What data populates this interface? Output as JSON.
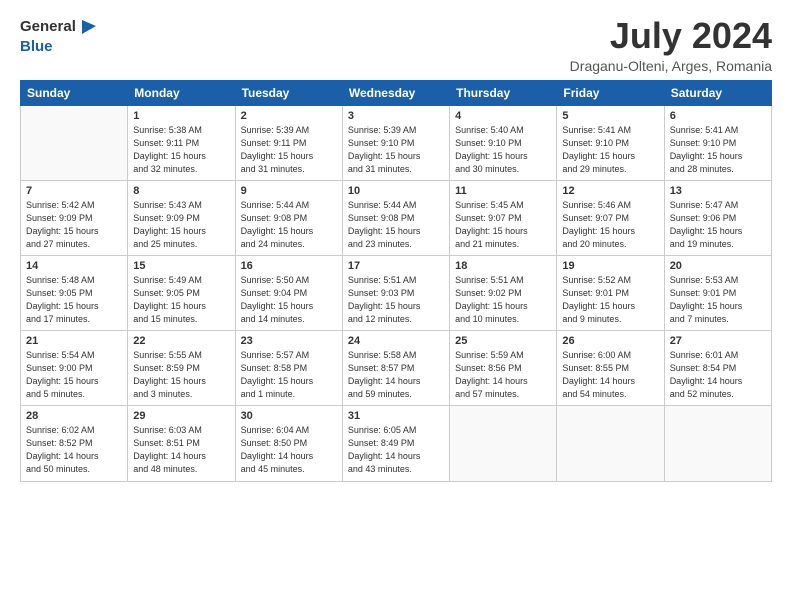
{
  "logo": {
    "line1": "General",
    "line2": "Blue"
  },
  "title": "July 2024",
  "subtitle": "Draganu-Olteni, Arges, Romania",
  "days_of_week": [
    "Sunday",
    "Monday",
    "Tuesday",
    "Wednesday",
    "Thursday",
    "Friday",
    "Saturday"
  ],
  "weeks": [
    [
      {
        "day": "",
        "info": ""
      },
      {
        "day": "1",
        "info": "Sunrise: 5:38 AM\nSunset: 9:11 PM\nDaylight: 15 hours\nand 32 minutes."
      },
      {
        "day": "2",
        "info": "Sunrise: 5:39 AM\nSunset: 9:11 PM\nDaylight: 15 hours\nand 31 minutes."
      },
      {
        "day": "3",
        "info": "Sunrise: 5:39 AM\nSunset: 9:10 PM\nDaylight: 15 hours\nand 31 minutes."
      },
      {
        "day": "4",
        "info": "Sunrise: 5:40 AM\nSunset: 9:10 PM\nDaylight: 15 hours\nand 30 minutes."
      },
      {
        "day": "5",
        "info": "Sunrise: 5:41 AM\nSunset: 9:10 PM\nDaylight: 15 hours\nand 29 minutes."
      },
      {
        "day": "6",
        "info": "Sunrise: 5:41 AM\nSunset: 9:10 PM\nDaylight: 15 hours\nand 28 minutes."
      }
    ],
    [
      {
        "day": "7",
        "info": "Sunrise: 5:42 AM\nSunset: 9:09 PM\nDaylight: 15 hours\nand 27 minutes."
      },
      {
        "day": "8",
        "info": "Sunrise: 5:43 AM\nSunset: 9:09 PM\nDaylight: 15 hours\nand 25 minutes."
      },
      {
        "day": "9",
        "info": "Sunrise: 5:44 AM\nSunset: 9:08 PM\nDaylight: 15 hours\nand 24 minutes."
      },
      {
        "day": "10",
        "info": "Sunrise: 5:44 AM\nSunset: 9:08 PM\nDaylight: 15 hours\nand 23 minutes."
      },
      {
        "day": "11",
        "info": "Sunrise: 5:45 AM\nSunset: 9:07 PM\nDaylight: 15 hours\nand 21 minutes."
      },
      {
        "day": "12",
        "info": "Sunrise: 5:46 AM\nSunset: 9:07 PM\nDaylight: 15 hours\nand 20 minutes."
      },
      {
        "day": "13",
        "info": "Sunrise: 5:47 AM\nSunset: 9:06 PM\nDaylight: 15 hours\nand 19 minutes."
      }
    ],
    [
      {
        "day": "14",
        "info": "Sunrise: 5:48 AM\nSunset: 9:05 PM\nDaylight: 15 hours\nand 17 minutes."
      },
      {
        "day": "15",
        "info": "Sunrise: 5:49 AM\nSunset: 9:05 PM\nDaylight: 15 hours\nand 15 minutes."
      },
      {
        "day": "16",
        "info": "Sunrise: 5:50 AM\nSunset: 9:04 PM\nDaylight: 15 hours\nand 14 minutes."
      },
      {
        "day": "17",
        "info": "Sunrise: 5:51 AM\nSunset: 9:03 PM\nDaylight: 15 hours\nand 12 minutes."
      },
      {
        "day": "18",
        "info": "Sunrise: 5:51 AM\nSunset: 9:02 PM\nDaylight: 15 hours\nand 10 minutes."
      },
      {
        "day": "19",
        "info": "Sunrise: 5:52 AM\nSunset: 9:01 PM\nDaylight: 15 hours\nand 9 minutes."
      },
      {
        "day": "20",
        "info": "Sunrise: 5:53 AM\nSunset: 9:01 PM\nDaylight: 15 hours\nand 7 minutes."
      }
    ],
    [
      {
        "day": "21",
        "info": "Sunrise: 5:54 AM\nSunset: 9:00 PM\nDaylight: 15 hours\nand 5 minutes."
      },
      {
        "day": "22",
        "info": "Sunrise: 5:55 AM\nSunset: 8:59 PM\nDaylight: 15 hours\nand 3 minutes."
      },
      {
        "day": "23",
        "info": "Sunrise: 5:57 AM\nSunset: 8:58 PM\nDaylight: 15 hours\nand 1 minute."
      },
      {
        "day": "24",
        "info": "Sunrise: 5:58 AM\nSunset: 8:57 PM\nDaylight: 14 hours\nand 59 minutes."
      },
      {
        "day": "25",
        "info": "Sunrise: 5:59 AM\nSunset: 8:56 PM\nDaylight: 14 hours\nand 57 minutes."
      },
      {
        "day": "26",
        "info": "Sunrise: 6:00 AM\nSunset: 8:55 PM\nDaylight: 14 hours\nand 54 minutes."
      },
      {
        "day": "27",
        "info": "Sunrise: 6:01 AM\nSunset: 8:54 PM\nDaylight: 14 hours\nand 52 minutes."
      }
    ],
    [
      {
        "day": "28",
        "info": "Sunrise: 6:02 AM\nSunset: 8:52 PM\nDaylight: 14 hours\nand 50 minutes."
      },
      {
        "day": "29",
        "info": "Sunrise: 6:03 AM\nSunset: 8:51 PM\nDaylight: 14 hours\nand 48 minutes."
      },
      {
        "day": "30",
        "info": "Sunrise: 6:04 AM\nSunset: 8:50 PM\nDaylight: 14 hours\nand 45 minutes."
      },
      {
        "day": "31",
        "info": "Sunrise: 6:05 AM\nSunset: 8:49 PM\nDaylight: 14 hours\nand 43 minutes."
      },
      {
        "day": "",
        "info": ""
      },
      {
        "day": "",
        "info": ""
      },
      {
        "day": "",
        "info": ""
      }
    ]
  ]
}
